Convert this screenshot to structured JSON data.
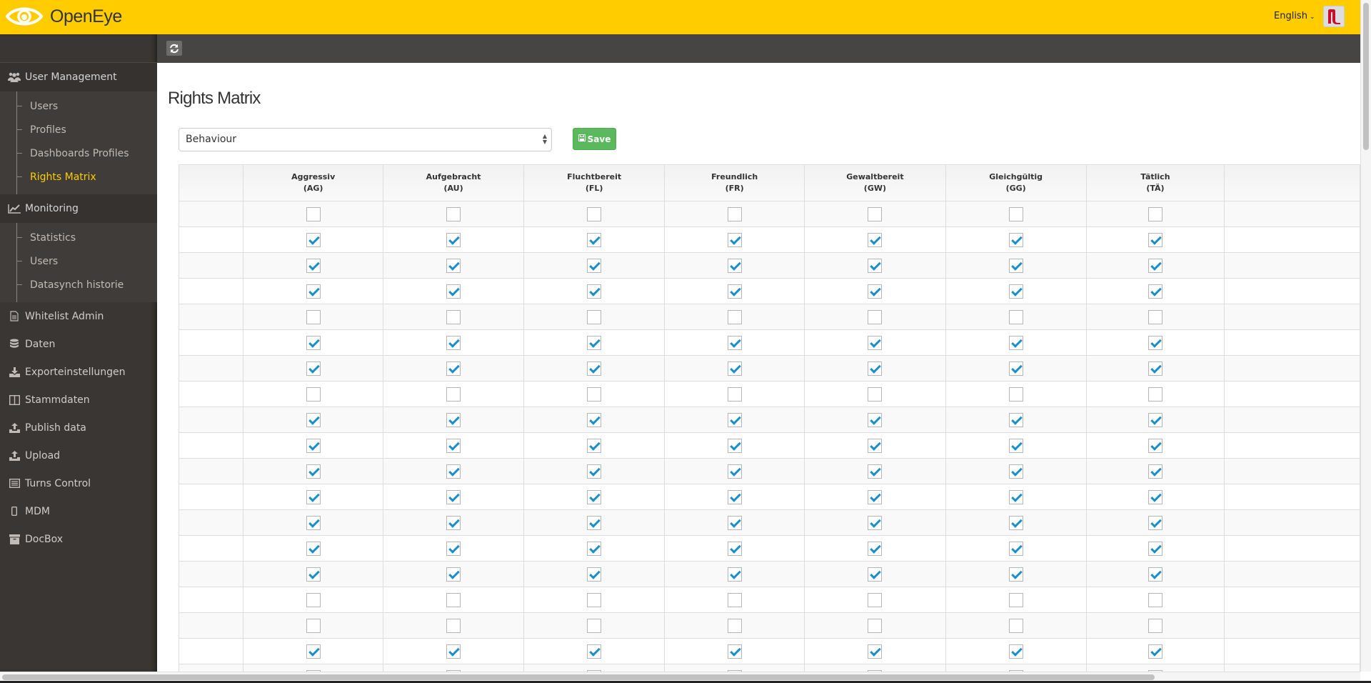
{
  "app": {
    "name": "OpenEye",
    "language": "English"
  },
  "sidebar": {
    "sections": [
      {
        "label": "User Management",
        "icon": "users-icon",
        "items": [
          {
            "label": "Users"
          },
          {
            "label": "Profiles"
          },
          {
            "label": "Dashboards Profiles"
          },
          {
            "label": "Rights Matrix",
            "active": true
          }
        ]
      },
      {
        "label": "Monitoring",
        "icon": "line-chart-icon",
        "items": [
          {
            "label": "Statistics"
          },
          {
            "label": "Users"
          },
          {
            "label": "Datasynch historie"
          }
        ]
      }
    ],
    "items": [
      {
        "label": "Whitelist Admin",
        "icon": "file-text-icon"
      },
      {
        "label": "Daten",
        "icon": "database-icon"
      },
      {
        "label": "Exporteinstellungen",
        "icon": "download-icon"
      },
      {
        "label": "Stammdaten",
        "icon": "columns-icon"
      },
      {
        "label": "Publish data",
        "icon": "upload-icon"
      },
      {
        "label": "Upload",
        "icon": "upload-icon"
      },
      {
        "label": "Turns Control",
        "icon": "list-alt-icon"
      },
      {
        "label": "MDM",
        "icon": "mobile-icon"
      },
      {
        "label": "DocBox",
        "icon": "archive-icon"
      }
    ]
  },
  "page": {
    "title": "Rights Matrix",
    "select": {
      "value": "Behaviour"
    },
    "save_label": "Save"
  },
  "matrix": {
    "columns": [
      {
        "name": "Aggressiv",
        "code": "(AG)"
      },
      {
        "name": "Aufgebracht",
        "code": "(AU)"
      },
      {
        "name": "Fluchtbereit",
        "code": "(FL)"
      },
      {
        "name": "Freundlich",
        "code": "(FR)"
      },
      {
        "name": "Gewaltbereit",
        "code": "(GW)"
      },
      {
        "name": "Gleichgültig",
        "code": "(GG)"
      },
      {
        "name": "Tätlich",
        "code": "(TÄ)"
      },
      {
        "name": "",
        "code": ""
      }
    ],
    "rows": [
      {
        "label": "",
        "checked": false
      },
      {
        "label": "",
        "checked": true
      },
      {
        "label": "",
        "checked": true
      },
      {
        "label": "",
        "checked": true
      },
      {
        "label": "",
        "checked": false
      },
      {
        "label": "",
        "checked": true
      },
      {
        "label": "",
        "checked": true
      },
      {
        "label": "",
        "checked": false
      },
      {
        "label": "",
        "checked": true
      },
      {
        "label": "",
        "checked": true
      },
      {
        "label": "",
        "checked": true
      },
      {
        "label": "",
        "checked": true
      },
      {
        "label": "",
        "checked": true
      },
      {
        "label": "",
        "checked": true
      },
      {
        "label": "",
        "checked": true
      },
      {
        "label": "",
        "checked": false
      },
      {
        "label": "",
        "checked": false
      },
      {
        "label": "",
        "checked": true
      },
      {
        "label": "",
        "checked": false
      }
    ]
  }
}
